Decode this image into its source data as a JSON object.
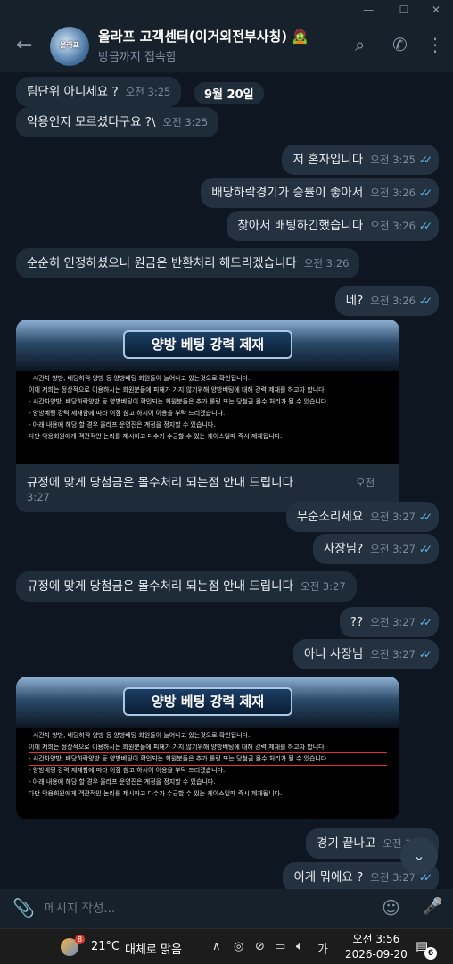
{
  "window": {
    "minimize": "—",
    "maximize": "☐",
    "close": "✕"
  },
  "header": {
    "title": "올라프 고객센터(이거외전부사칭) 🧟",
    "status": "방금까지 접속함",
    "avatar_text": "올라프"
  },
  "date_pill": "9월 20일",
  "messages": [
    {
      "text": "팀단위 아니세요 ?",
      "time": "오전 3:25"
    },
    {
      "text": "악용인지 모르셨다구요 ?\\",
      "time": "오전 3:25"
    },
    {
      "text": "저 혼자입니다",
      "time": "오전 3:25"
    },
    {
      "text": "배당하락경기가 승률이 좋아서",
      "time": "오전 3:26"
    },
    {
      "text": "찾아서 배팅하긴했습니다",
      "time": "오전 3:26"
    },
    {
      "text": "순순히 인정하셨으니 원금은 반환처리 해드리겠습니다",
      "time": "오전 3:26"
    },
    {
      "text": "네?",
      "time": "오전 3:26"
    },
    {
      "text": "규정에 맞게 당첨금은 몰수처리 되는점 안내 드립니다",
      "time": "오전 3:27"
    },
    {
      "text": "무순소리세요",
      "time": "오전 3:27"
    },
    {
      "text": "사장님?",
      "time": "오전 3:27"
    },
    {
      "text": "규정에 맞게 당첨금은 몰수처리 되는점 안내 드립니다",
      "time": "오전 3:27"
    },
    {
      "text": "??",
      "time": "오전 3:27"
    },
    {
      "text": "아니 사장님",
      "time": "오전 3:27"
    },
    {
      "text": "경기 끝나고",
      "time": "오전 3:27"
    },
    {
      "text": "이게 뭐에요 ?",
      "time": "오전 3:27"
    }
  ],
  "notice": {
    "title": "양방 베팅 강력 제재",
    "lines": [
      "- 시간차 양방, 배당하락 양방 등 양방베팅 회원들이 늘어나고 있는것으로 확인됩니다.",
      "  이에 저희는 정상적으로 이용하시는 회원분들에 피해가 가지 않기위해 양방베팅에 대해 강력 제재를 하고자 합니다.",
      "- 시간차양방, 배당하락양방 등 양방베팅이 확인되는 회원분들은 추가 롤링 또는 당첨금 몰수 처리가 될 수 있습니다.",
      "- 양방베팅 강력 제재함에 따라 이점 참고 하시어 이용을 부탁 드리겠습니다.",
      "- 아래 내용에 해당 할 경우 올라프 운영진은 계정을 정지할 수 있습니다.",
      "  다만 악용회원에게 객관적인 논리를 제시하고 다수가 수긍할 수 있는 케이스일때 즉시 제재됩니다."
    ]
  },
  "composer": {
    "placeholder": "메시지 작성..."
  },
  "taskbar": {
    "temperature": "21°C",
    "condition": "대체로 맑음",
    "ime": "가",
    "time": "오전 3:56",
    "date": "2026-09-20",
    "notification_count": "6",
    "weather_badge": "8"
  }
}
